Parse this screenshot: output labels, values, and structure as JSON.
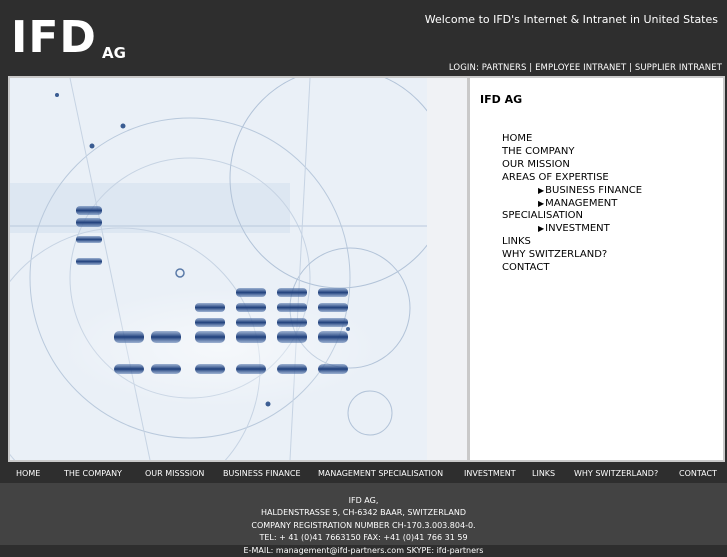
{
  "header": {
    "logo_main": "IFD",
    "logo_sub": "AG",
    "welcome": "Welcome to IFD's Internet & Intranet in United States",
    "login_prefix": "LOGIN:",
    "login_links": [
      "PARTNERS",
      "EMPLOYEE INTRANET",
      "SUPPLIER INTRANET"
    ],
    "separator": "|"
  },
  "sidebar": {
    "title": "IFD AG",
    "menu": [
      {
        "label": "HOME"
      },
      {
        "label": "THE COMPANY"
      },
      {
        "label": "OUR MISSION"
      },
      {
        "label": "AREAS OF EXPERTISE"
      },
      {
        "label": "BUSINESS FINANCE"
      },
      {
        "label": "MANAGEMENT"
      },
      {
        "label": "SPECIALISATION"
      },
      {
        "label": "INVESTMENT"
      },
      {
        "label": "LINKS"
      },
      {
        "label": "WHY SWITZERLAND?"
      },
      {
        "label": "CONTACT"
      }
    ],
    "arrow_icon": "right-triangle-icon"
  },
  "footer_nav": [
    "HOME",
    "THE COMPANY",
    "OUR MISSSION",
    "BUSINESS FINANCE",
    "MANAGEMENT SPECIALISATION",
    "INVESTMENT",
    "LINKS",
    "WHY SWITZERLAND?",
    "CONTACT"
  ],
  "address": {
    "line1": "IFD AG,",
    "line2": "HALDENSTRASSE 5, CH-6342 BAAR, SWITZERLAND",
    "line3": "COMPANY REGISTRATION NUMBER CH-170.3.003.804-0.",
    "line4": "TEL: + 41 (0)41 7663150 FAX: +41 (0)41 766 31 59",
    "line5": "E-MAIL: management@ifd-partners.com SKYPE: ifd-partners"
  },
  "colors": {
    "header_bg": "#2e2e2e",
    "address_bg": "#434343",
    "gel_band": "#1e3e7a"
  }
}
